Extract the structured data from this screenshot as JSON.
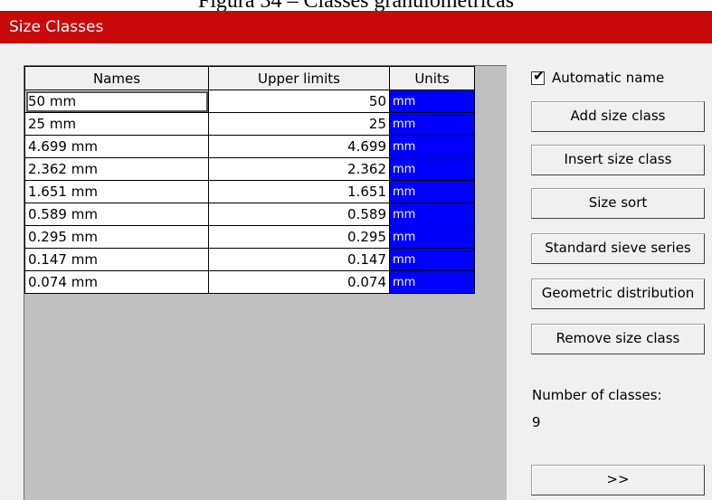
{
  "caption": "Figura 34 – Classes granulométricas",
  "window": {
    "title": "Size Classes"
  },
  "grid": {
    "headers": [
      "Names",
      "Upper limits",
      "Units"
    ],
    "rows": [
      {
        "name": "50 mm",
        "upper": "50",
        "unit": "mm"
      },
      {
        "name": "25 mm",
        "upper": "25",
        "unit": "mm"
      },
      {
        "name": "4.699 mm",
        "upper": "4.699",
        "unit": "mm"
      },
      {
        "name": "2.362 mm",
        "upper": "2.362",
        "unit": "mm"
      },
      {
        "name": "1.651 mm",
        "upper": "1.651",
        "unit": "mm"
      },
      {
        "name": "0.589 mm",
        "upper": "0.589",
        "unit": "mm"
      },
      {
        "name": "0.295 mm",
        "upper": "0.295",
        "unit": "mm"
      },
      {
        "name": "0.147 mm",
        "upper": "0.147",
        "unit": "mm"
      },
      {
        "name": "0.074 mm",
        "upper": "0.074",
        "unit": "mm"
      }
    ]
  },
  "side": {
    "automatic_name_label": "Automatic name",
    "automatic_name_checked": true,
    "buttons": {
      "add": "Add size class",
      "insert": "Insert size class",
      "sort": "Size sort",
      "standard": "Standard sieve series",
      "geometric": "Geometric distribution",
      "remove": "Remove size class",
      "next": ">>"
    },
    "count_label": "Number of classes:",
    "count_value": "9"
  },
  "colors": {
    "titlebar": "#c8090a",
    "unit_cell": "#0000ff",
    "grid_bg": "#c0c0c0"
  }
}
